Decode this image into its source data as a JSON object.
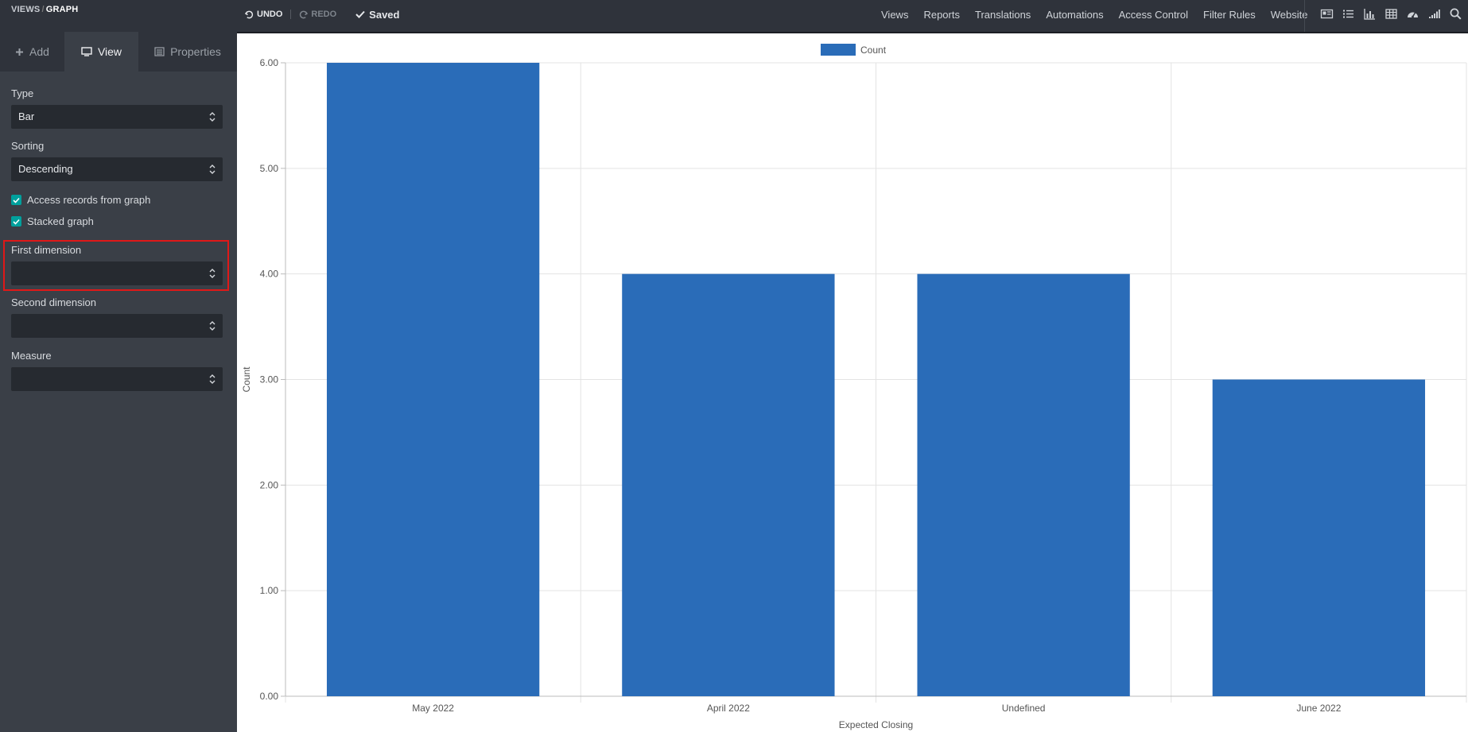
{
  "breadcrumb": {
    "parent": "VIEWS",
    "separator": "/",
    "current": "GRAPH"
  },
  "history": {
    "undo": "UNDO",
    "redo": "REDO",
    "saved": "Saved"
  },
  "menu": [
    "Views",
    "Reports",
    "Translations",
    "Automations",
    "Access Control",
    "Filter Rules",
    "Website"
  ],
  "view_switcher_icons": [
    "form-view-icon",
    "list-view-icon",
    "graph-view-icon",
    "pivot-view-icon",
    "dashboard-view-icon",
    "cohort-view-icon",
    "search-icon"
  ],
  "sidebar": {
    "tabs": [
      {
        "label": "Add",
        "icon": "plus-icon"
      },
      {
        "label": "View",
        "icon": "monitor-icon",
        "active": true
      },
      {
        "label": "Properties",
        "icon": "list-icon"
      }
    ],
    "type": {
      "label": "Type",
      "value": "Bar"
    },
    "sorting": {
      "label": "Sorting",
      "value": "Descending"
    },
    "access_records": {
      "label": "Access records from graph",
      "checked": true
    },
    "stacked": {
      "label": "Stacked graph",
      "checked": true
    },
    "first_dimension": {
      "label": "First dimension",
      "value": ""
    },
    "second_dimension": {
      "label": "Second dimension",
      "value": ""
    },
    "measure": {
      "label": "Measure",
      "value": ""
    }
  },
  "colors": {
    "bar": "#2a6cb8",
    "accent": "#00a09d",
    "highlight": "#e01818"
  },
  "chart_data": {
    "type": "bar",
    "categories": [
      "May 2022",
      "April 2022",
      "Undefined",
      "June 2022"
    ],
    "series": [
      {
        "name": "Count",
        "values": [
          6,
          4,
          4,
          3
        ]
      }
    ],
    "xlabel": "Expected Closing",
    "ylabel": "Count",
    "ylim": [
      0,
      6
    ],
    "yticks": [
      "0.00",
      "1.00",
      "2.00",
      "3.00",
      "4.00",
      "5.00",
      "6.00"
    ],
    "legend": "top-center",
    "grid": true
  }
}
